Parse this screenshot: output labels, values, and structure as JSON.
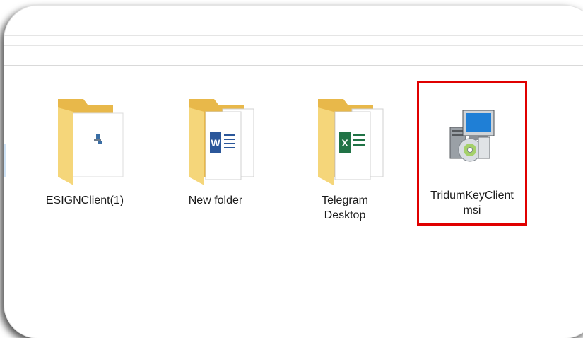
{
  "colors": {
    "folder_front": "#f5d67a",
    "folder_back": "#e8b84a",
    "highlight": "#e00000",
    "word": "#2b579a",
    "excel": "#217346"
  },
  "files": [
    {
      "label": "ESIGNClient(1)",
      "icon": "folder-with-app-icon"
    },
    {
      "label": "New folder",
      "icon": "folder-with-word-icon"
    },
    {
      "label": "Telegram\nDesktop",
      "icon": "folder-with-excel-icon"
    },
    {
      "label": "TridumKeyClient\nmsi",
      "icon": "msi-installer-icon"
    }
  ]
}
